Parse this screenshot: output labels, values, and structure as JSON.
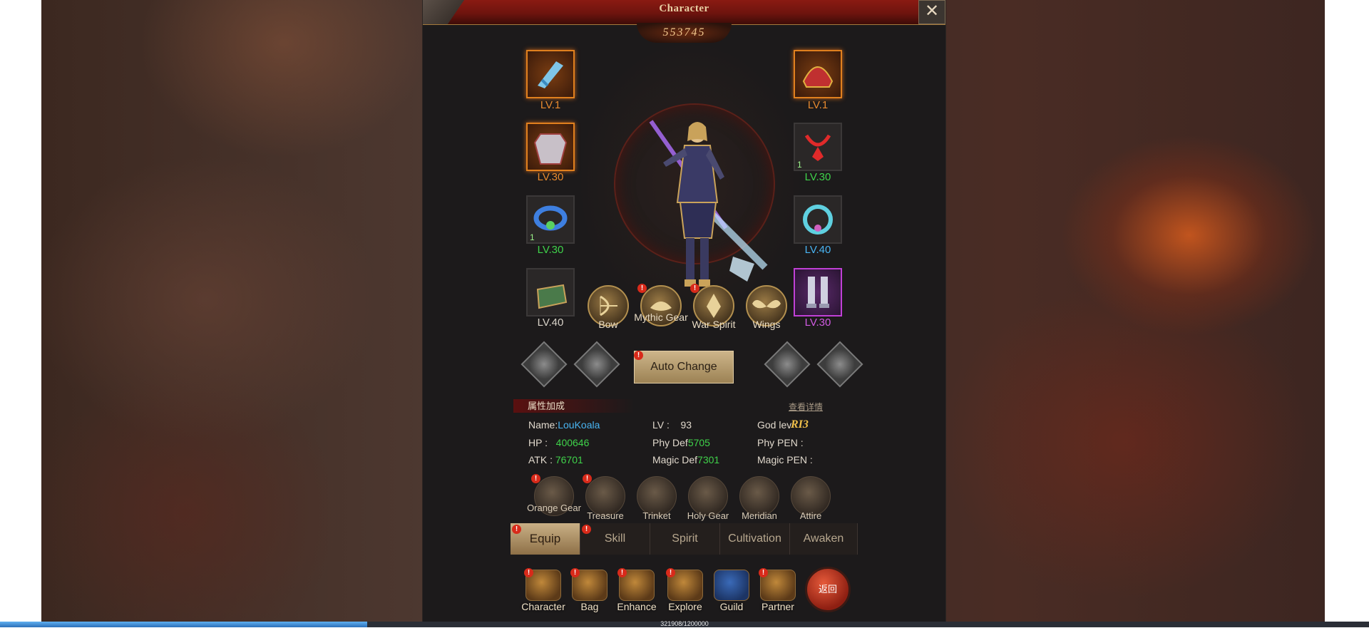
{
  "window": {
    "title": "Character",
    "power": "553745"
  },
  "equipment": {
    "left": [
      {
        "name": "weapon",
        "level": "LV.1",
        "rarity": "orange",
        "count": ""
      },
      {
        "name": "armor",
        "level": "LV.30",
        "rarity": "orange",
        "count": ""
      },
      {
        "name": "ring",
        "level": "LV.30",
        "rarity": "green",
        "count": "1"
      },
      {
        "name": "gloves",
        "level": "LV.40",
        "rarity": "white",
        "count": ""
      }
    ],
    "right": [
      {
        "name": "helmet",
        "level": "LV.1",
        "rarity": "orange",
        "count": ""
      },
      {
        "name": "necklace",
        "level": "LV.30",
        "rarity": "green",
        "count": "1"
      },
      {
        "name": "bracelet",
        "level": "LV.40",
        "rarity": "blue",
        "count": ""
      },
      {
        "name": "boots",
        "level": "LV.30",
        "rarity": "purple",
        "count": ""
      }
    ]
  },
  "gear_buttons": [
    {
      "label": "Bow",
      "badge": false
    },
    {
      "label": "Mythic Gear",
      "badge": true
    },
    {
      "label": "War Spirit",
      "badge": true
    },
    {
      "label": "Wings",
      "badge": false
    }
  ],
  "auto_change": {
    "label": "Auto Change"
  },
  "attributes": {
    "header": "属性加成",
    "detail_link": "查看详情",
    "name_label": "Name:",
    "name_value": "LouKoala",
    "lv_label": "LV :",
    "lv_value": "93",
    "god_label": "God lev",
    "god_value": "RI3",
    "hp_label": "HP :",
    "hp_value": "400646",
    "phydef_label": "Phy Def",
    "phydef_value": "5705",
    "phypen_label": "Phy PEN :",
    "atk_label": "ATK :",
    "atk_value": "76701",
    "magicdef_label": "Magic Def",
    "magicdef_value": "7301",
    "magicpen_label": "Magic PEN :"
  },
  "sub_buttons": [
    {
      "label": "Orange Gear",
      "badge": true
    },
    {
      "label": "Treasure",
      "badge": true
    },
    {
      "label": "Trinket",
      "badge": false
    },
    {
      "label": "Holy Gear",
      "badge": false
    },
    {
      "label": "Meridian",
      "badge": false
    },
    {
      "label": "Attire",
      "badge": false
    }
  ],
  "tabs": [
    {
      "label": "Equip",
      "active": true,
      "badge": true
    },
    {
      "label": "Skill",
      "active": false,
      "badge": true
    },
    {
      "label": "Spirit",
      "active": false,
      "badge": false
    },
    {
      "label": "Cultivation",
      "active": false,
      "badge": false
    },
    {
      "label": "Awaken",
      "active": false,
      "badge": false
    }
  ],
  "bottom_nav": [
    {
      "label": "Character",
      "badge": true
    },
    {
      "label": "Bag",
      "badge": true
    },
    {
      "label": "Enhance",
      "badge": true
    },
    {
      "label": "Explore",
      "badge": true
    },
    {
      "label": "Guild",
      "badge": false
    },
    {
      "label": "Partner",
      "badge": true
    }
  ],
  "back_button": {
    "label": "返回"
  },
  "xp": {
    "text": "321908/1200000",
    "fraction": 0.268
  },
  "colors": {
    "orange": "#e88a2e",
    "green": "#3fd24a",
    "blue": "#49b4f2",
    "purple": "#d15be3",
    "badge": "#d82a1a"
  }
}
